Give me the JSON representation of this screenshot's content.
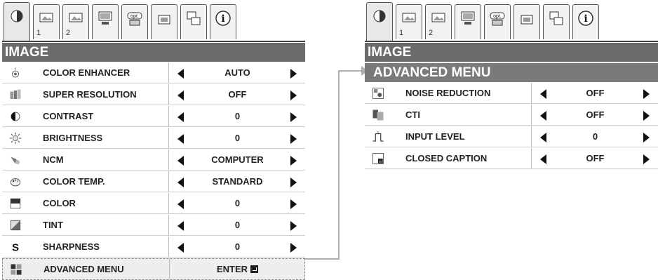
{
  "tabs": [
    {
      "icon": "image-adjust-icon",
      "num": ""
    },
    {
      "icon": "setting-1-icon",
      "num": "1"
    },
    {
      "icon": "setting-2-icon",
      "num": "2"
    },
    {
      "icon": "installation-icon",
      "num": ""
    },
    {
      "icon": "option-icon",
      "num": "",
      "text": "opt."
    },
    {
      "icon": "signal-icon",
      "num": ""
    },
    {
      "icon": "network-icon",
      "num": ""
    },
    {
      "icon": "info-icon",
      "num": ""
    }
  ],
  "left": {
    "title": "IMAGE",
    "rows": [
      {
        "icon": "color-enhancer-icon",
        "label": "COLOR ENHANCER",
        "value": "AUTO"
      },
      {
        "icon": "super-resolution-icon",
        "label": "SUPER RESOLUTION",
        "value": "OFF"
      },
      {
        "icon": "contrast-icon",
        "label": "CONTRAST",
        "value": "0"
      },
      {
        "icon": "brightness-icon",
        "label": "BRIGHTNESS",
        "value": "0"
      },
      {
        "icon": "ncm-icon",
        "label": "NCM",
        "value": "COMPUTER"
      },
      {
        "icon": "color-temp-icon",
        "label": "COLOR TEMP.",
        "value": "STANDARD"
      },
      {
        "icon": "color-icon",
        "label": "COLOR",
        "value": "0"
      },
      {
        "icon": "tint-icon",
        "label": "TINT",
        "value": "0"
      },
      {
        "icon": "sharpness-icon",
        "label": "SHARPNESS",
        "value": "0",
        "glyph": "S"
      }
    ],
    "advanced": {
      "icon": "advanced-menu-icon",
      "label": "ADVANCED MENU",
      "value": "ENTER"
    }
  },
  "right": {
    "title": "IMAGE",
    "subtitle": "ADVANCED MENU",
    "rows": [
      {
        "icon": "noise-reduction-icon",
        "label": "NOISE REDUCTION",
        "value": "OFF"
      },
      {
        "icon": "cti-icon",
        "label": "CTI",
        "value": "OFF"
      },
      {
        "icon": "input-level-icon",
        "label": "INPUT LEVEL",
        "value": "0"
      },
      {
        "icon": "closed-caption-icon",
        "label": "CLOSED CAPTION",
        "value": "OFF"
      }
    ]
  },
  "colors": {
    "title_bg": "#6b6b6b",
    "subhead_bg": "#7a7a7a",
    "connector": "#b0b0b0"
  }
}
